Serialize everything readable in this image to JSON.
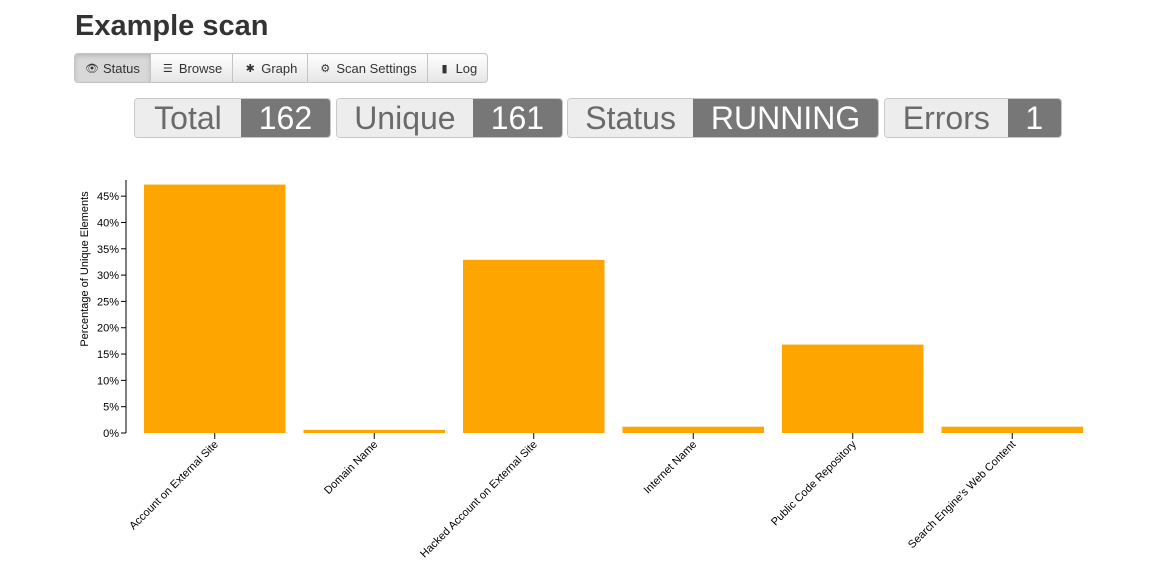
{
  "page": {
    "title": "Example scan"
  },
  "tabs": [
    {
      "label": "Status",
      "icon": "eye-icon",
      "active": true
    },
    {
      "label": "Browse",
      "icon": "list-icon",
      "active": false
    },
    {
      "label": "Graph",
      "icon": "asterisk-icon",
      "active": false
    },
    {
      "label": "Scan Settings",
      "icon": "gear-icon",
      "active": false
    },
    {
      "label": "Log",
      "icon": "book-icon",
      "active": false
    }
  ],
  "stats": {
    "total": {
      "label": "Total",
      "value": "162"
    },
    "unique": {
      "label": "Unique",
      "value": "161"
    },
    "status": {
      "label": "Status",
      "value": "RUNNING"
    },
    "errors": {
      "label": "Errors",
      "value": "1"
    }
  },
  "colors": {
    "bar": "#ffa500",
    "badge_value_bg": "#777777",
    "badge_label_bg": "#ededed"
  },
  "chart_data": {
    "type": "bar",
    "ylabel": "Percentage of Unique Elements",
    "xlabel": "",
    "categories": [
      "Account on External Site",
      "Domain Name",
      "Hacked Account on External Site",
      "Internet Name",
      "Public Code Repository",
      "Search Engine's Web Content"
    ],
    "values": [
      47.2,
      0.6,
      32.9,
      1.2,
      16.8,
      1.2
    ],
    "ylim": [
      0,
      47.5
    ],
    "yticks": [
      "0%",
      "5%",
      "10%",
      "15%",
      "20%",
      "25%",
      "30%",
      "35%",
      "40%",
      "45%"
    ],
    "grid": false
  }
}
